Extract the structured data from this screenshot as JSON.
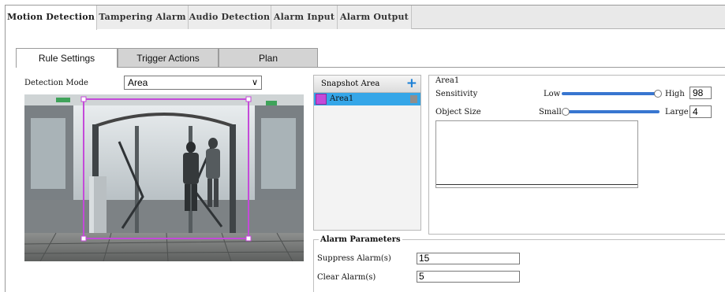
{
  "top_tabs": [
    {
      "label": "Motion Detection",
      "active": true
    },
    {
      "label": "Tampering Alarm",
      "active": false
    },
    {
      "label": "Audio Detection",
      "active": false
    },
    {
      "label": "Alarm Input",
      "active": false
    },
    {
      "label": "Alarm Output",
      "active": false
    }
  ],
  "sub_tabs": [
    {
      "label": "Rule Settings",
      "active": true
    },
    {
      "label": "Trigger Actions",
      "active": false
    },
    {
      "label": "Plan",
      "active": false
    }
  ],
  "detection_mode": {
    "label": "Detection Mode",
    "value": "Area"
  },
  "snapshot": {
    "header": "Snapshot Area",
    "add_icon": "plus-icon",
    "items": [
      {
        "label": "Area1",
        "color": "#c44ad9",
        "selected": true
      }
    ]
  },
  "area": {
    "title": "Area1",
    "sensitivity": {
      "label": "Sensitivity",
      "low": "Low",
      "high": "High",
      "value": "98",
      "fraction": 0.98
    },
    "object_size": {
      "label": "Object Size",
      "small": "Small",
      "large": "Large",
      "value": "4",
      "fraction": 0.04
    }
  },
  "alarm": {
    "title": "Alarm Parameters",
    "suppress": {
      "label": "Suppress Alarm(s)",
      "value": "15"
    },
    "clear": {
      "label": "Clear Alarm(s)",
      "value": "5"
    }
  },
  "colors": {
    "accent_blue": "#35a6e8",
    "region_purple": "#c44ad9",
    "slider_blue": "#3876d0"
  }
}
